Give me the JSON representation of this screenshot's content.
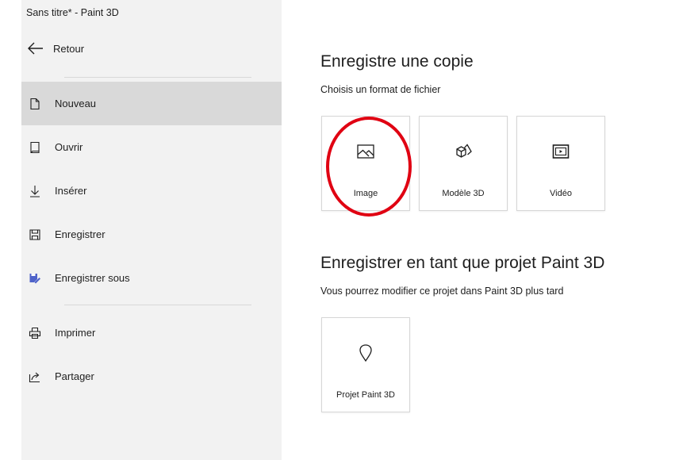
{
  "window": {
    "title": "Sans titre* - Paint 3D"
  },
  "sidebar": {
    "back_label": "Retour",
    "items": [
      {
        "label": "Nouveau",
        "icon": "new-file-icon",
        "selected": true
      },
      {
        "label": "Ouvrir",
        "icon": "open-file-icon"
      },
      {
        "label": "Insérer",
        "icon": "insert-arrow-icon"
      },
      {
        "label": "Enregistrer",
        "icon": "save-disk-icon"
      },
      {
        "label": "Enregistrer sous",
        "icon": "save-as-icon"
      },
      {
        "label": "Imprimer",
        "icon": "printer-icon"
      },
      {
        "label": "Partager",
        "icon": "share-icon"
      }
    ]
  },
  "save_copy": {
    "title": "Enregistre une copie",
    "subtitle": "Choisis un format de fichier",
    "formats": [
      {
        "label": "Image",
        "icon": "image-icon",
        "highlighted": true
      },
      {
        "label": "Modèle 3D",
        "icon": "3d-model-icon"
      },
      {
        "label": "Vidéo",
        "icon": "video-icon"
      }
    ]
  },
  "save_project": {
    "title": "Enregistrer en tant que projet Paint 3D",
    "subtitle": "Vous pourrez modifier ce projet dans Paint 3D plus tard",
    "option": {
      "label": "Projet Paint 3D",
      "icon": "paint3d-project-icon"
    }
  },
  "colors": {
    "sidebar_bg": "#f2f2f2",
    "selected_bg": "#d9d9d9",
    "highlight_ring": "#e00012",
    "accent": "#5b4fc7"
  }
}
